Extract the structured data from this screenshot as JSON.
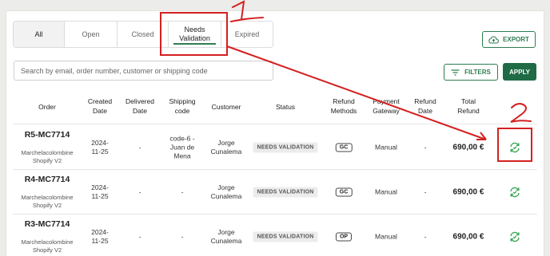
{
  "tabs": [
    {
      "label": "All"
    },
    {
      "label": "Open"
    },
    {
      "label": "Closed"
    },
    {
      "label": "Needs\nValidation"
    },
    {
      "label": "Expired"
    }
  ],
  "toolbar": {
    "export_label": "EXPORT",
    "filters_label": "FILTERS",
    "apply_label": "APPLY",
    "search_placeholder": "Search by email, order number, customer or shipping code"
  },
  "table": {
    "columns": [
      "Order",
      "Created\nDate",
      "Delivered\nDate",
      "Shipping\ncode",
      "Customer",
      "Status",
      "Refund\nMethods",
      "Payment\nGateway",
      "Refund\nDate",
      "Total\nRefund"
    ],
    "rows": [
      {
        "order_id": "R5-MC7714",
        "shop": "Marchelacolombine\nShopify V2",
        "created": "2024-\n11-25",
        "delivered": "-",
        "shipping": "code-6 -\nJuan de\nMena",
        "customer": "Jorge\nCunalema",
        "status": "NEEDS VALIDATION",
        "method": "GC",
        "gateway": "Manual",
        "refund_date": "-",
        "total": "690,00 €"
      },
      {
        "order_id": "R4-MC7714",
        "shop": "Marchelacolombine\nShopify V2",
        "created": "2024-\n11-25",
        "delivered": "-",
        "shipping": "-",
        "customer": "Jorge\nCunalema",
        "status": "NEEDS VALIDATION",
        "method": "GC",
        "gateway": "Manual",
        "refund_date": "-",
        "total": "690,00 €"
      },
      {
        "order_id": "R3-MC7714",
        "shop": "Marchelacolombine\nShopify V2",
        "created": "2024-\n11-25",
        "delivered": "-",
        "shipping": "-",
        "customer": "Jorge\nCunalema",
        "status": "NEEDS VALIDATION",
        "method": "OP",
        "gateway": "Manual",
        "refund_date": "-",
        "total": "690,00 €"
      }
    ]
  },
  "annotations": {
    "color": "#d42020",
    "numbers": [
      "1",
      "2"
    ]
  },
  "colors": {
    "accent": "#2e7d4f",
    "apply_bg": "#1f6b46",
    "sync_icon": "#3aa655"
  }
}
